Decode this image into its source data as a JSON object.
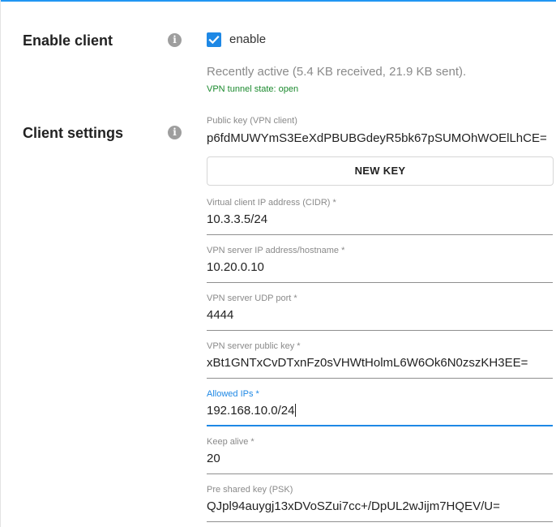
{
  "colors": {
    "accent": "#1e88e5",
    "tunnel_state": "#1b8a2e",
    "muted": "#8a8a8a"
  },
  "enable_client": {
    "title": "Enable client",
    "info_icon": "info-icon",
    "checkbox_checked": true,
    "checkbox_label": "enable",
    "activity": "Recently active (5.4 KB received, 21.9 KB sent).",
    "tunnel_state": "VPN tunnel state: open"
  },
  "client_settings": {
    "title": "Client settings",
    "info_icon": "info-icon",
    "public_key_label": "Public key (VPN client)",
    "public_key_value": "p6fdMUWYmS3EeXdPBUBGdeyR5bk67pSUMOhWOElLhCE=",
    "new_key_button": "NEW KEY",
    "fields": [
      {
        "label": "Virtual client IP address (CIDR) *",
        "value": "10.3.3.5/24"
      },
      {
        "label": "VPN server IP address/hostname *",
        "value": "10.20.0.10"
      },
      {
        "label": "VPN server UDP port *",
        "value": "4444"
      },
      {
        "label": "VPN server public key *",
        "value": "xBt1GNTxCvDTxnFz0sVHWtHolmL6W6Ok6N0zszKH3EE="
      },
      {
        "label": "Allowed IPs *",
        "value": "192.168.10.0/24"
      },
      {
        "label": "Keep alive *",
        "value": "20"
      },
      {
        "label": "Pre shared key (PSK)",
        "value": "QJpl94auygj13xDVoSZui7cc+/DpUL2wJijm7HQEV/U="
      }
    ]
  }
}
